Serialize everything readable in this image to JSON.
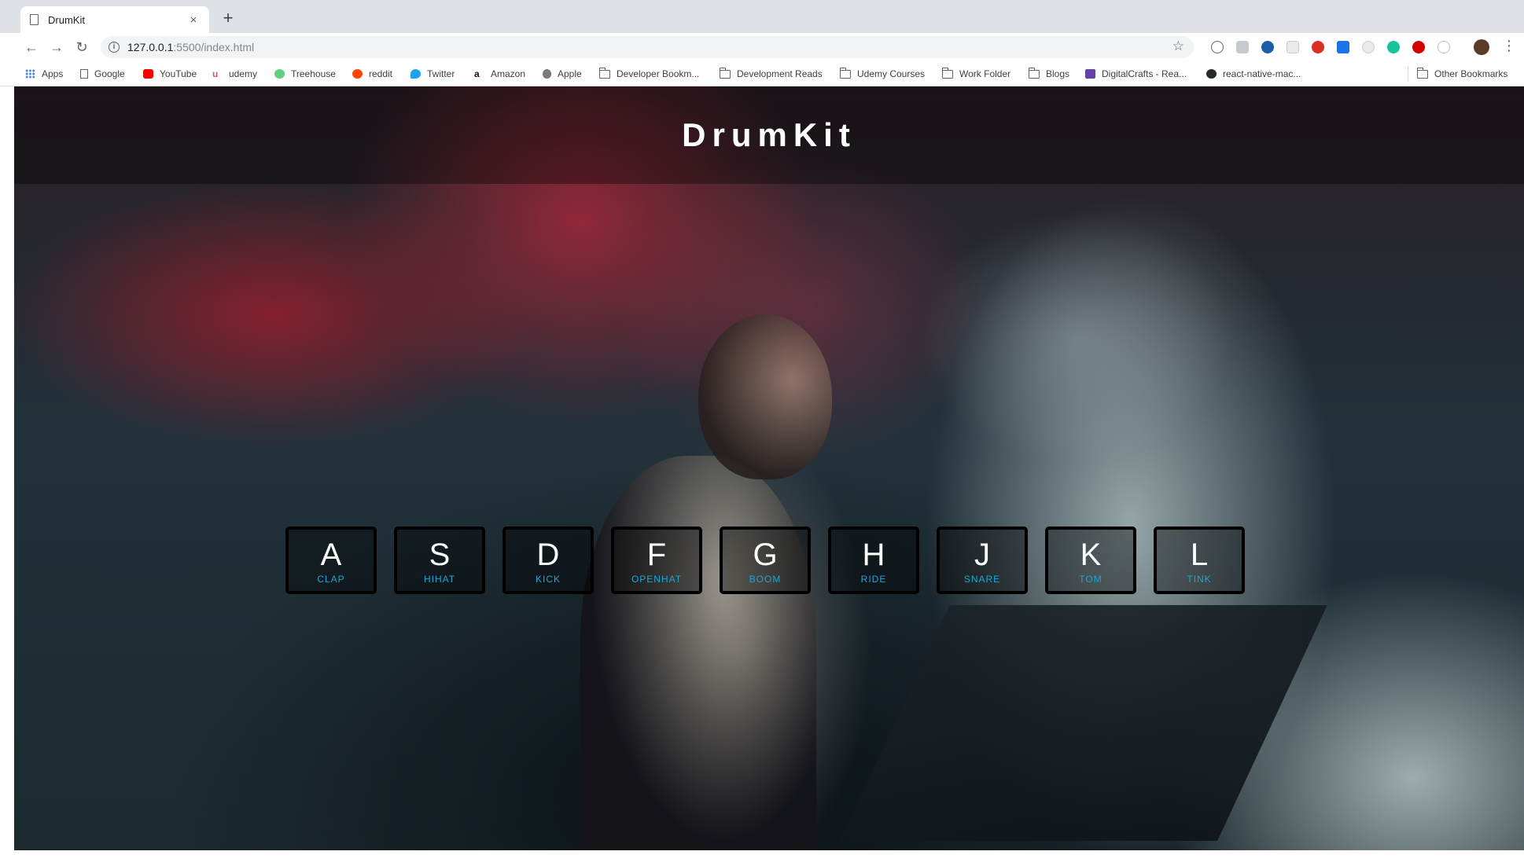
{
  "browser": {
    "tab_title": "DrumKit",
    "tab_close": "×",
    "new_tab": "+",
    "url_host": "127.0.0.1",
    "url_rest": ":5500/index.html",
    "back": "←",
    "forward": "→",
    "reload": "↻",
    "star": "☆",
    "menu": "⋮",
    "info": "i"
  },
  "bookmarks": [
    {
      "label": "Apps",
      "icon": "apps-grid-icon"
    },
    {
      "label": "Google",
      "icon": "page-icon"
    },
    {
      "label": "YouTube",
      "icon": "youtube-icon"
    },
    {
      "label": "udemy",
      "icon": "udemy-icon"
    },
    {
      "label": "Treehouse",
      "icon": "treehouse-icon"
    },
    {
      "label": "reddit",
      "icon": "reddit-icon"
    },
    {
      "label": "Twitter",
      "icon": "twitter-icon"
    },
    {
      "label": "Amazon",
      "icon": "amazon-icon"
    },
    {
      "label": "Apple",
      "icon": "apple-icon"
    },
    {
      "label": "Developer Bookm...",
      "icon": "folder-icon"
    },
    {
      "label": "Development Reads",
      "icon": "folder-icon"
    },
    {
      "label": "Udemy Courses",
      "icon": "folder-icon"
    },
    {
      "label": "Work Folder",
      "icon": "folder-icon"
    },
    {
      "label": "Blogs",
      "icon": "folder-icon"
    },
    {
      "label": "DigitalCrafts - Rea...",
      "icon": "twitch-icon"
    },
    {
      "label": "react-native-mac...",
      "icon": "github-icon"
    },
    {
      "label": "Other Bookmarks",
      "icon": "folder-icon"
    }
  ],
  "page": {
    "title": "DrumKit",
    "keys": [
      {
        "letter": "A",
        "sound": "CLAP"
      },
      {
        "letter": "S",
        "sound": "HIHAT"
      },
      {
        "letter": "D",
        "sound": "KICK"
      },
      {
        "letter": "F",
        "sound": "OPENHAT"
      },
      {
        "letter": "G",
        "sound": "BOOM"
      },
      {
        "letter": "H",
        "sound": "RIDE"
      },
      {
        "letter": "J",
        "sound": "SNARE"
      },
      {
        "letter": "K",
        "sound": "TOM"
      },
      {
        "letter": "L",
        "sound": "TINK"
      }
    ]
  },
  "colors": {
    "sound_label": "#1aa7d8",
    "key_border": "#000000",
    "title": "#ffffff"
  }
}
